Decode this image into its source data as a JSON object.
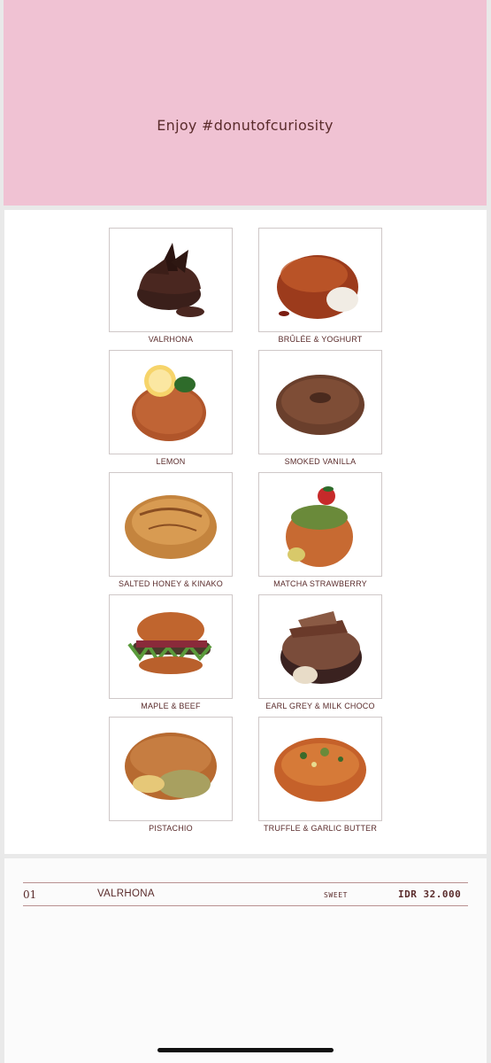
{
  "hero": {
    "tagline": "Enjoy #donutofcuriosity",
    "bg_color": "#f0c2d3"
  },
  "menu": {
    "items": [
      {
        "label": "VALRHONA",
        "icon": "chocolate-donut-image"
      },
      {
        "label": "BRÛLÉE & YOGHURT",
        "icon": "brulee-donut-image"
      },
      {
        "label": "LEMON",
        "icon": "lemon-donut-image"
      },
      {
        "label": "SMOKED VANILLA",
        "icon": "cinnamon-ring-donut-image"
      },
      {
        "label": "SALTED HONEY & KINAKO",
        "icon": "honey-donut-image"
      },
      {
        "label": "MATCHA STRAWBERRY",
        "icon": "matcha-donut-image"
      },
      {
        "label": "MAPLE & BEEF",
        "icon": "beef-burger-donut-image"
      },
      {
        "label": "EARL GREY & MILK CHOCO",
        "icon": "earl-grey-donut-image"
      },
      {
        "label": "PISTACHIO",
        "icon": "pistachio-donut-image"
      },
      {
        "label": "TRUFFLE & GARLIC BUTTER",
        "icon": "truffle-donut-image"
      }
    ]
  },
  "price_list": {
    "rows": [
      {
        "number": "01",
        "name": "VALRHONA",
        "category": "SWEET",
        "price": "IDR 32.000"
      }
    ]
  },
  "colors": {
    "text": "#5a2b2b",
    "rule": "#b89090"
  }
}
